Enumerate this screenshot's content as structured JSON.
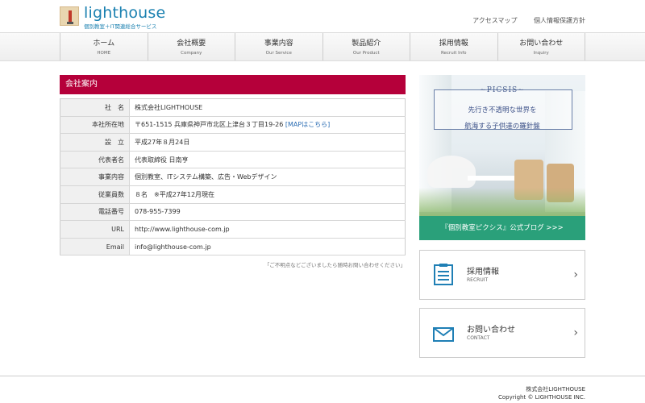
{
  "header": {
    "logo_text": "lighthouse",
    "logo_sub": "個別教室＋IT関連総合サービス",
    "links": [
      "アクセスマップ",
      "個人情報保護方針"
    ]
  },
  "nav": [
    {
      "jp": "ホーム",
      "en": "HOME"
    },
    {
      "jp": "会社概要",
      "en": "Company"
    },
    {
      "jp": "事業内容",
      "en": "Our Service"
    },
    {
      "jp": "製品紹介",
      "en": "Our Product"
    },
    {
      "jp": "採用情報",
      "en": "Recruit Info"
    },
    {
      "jp": "お問い合わせ",
      "en": "Inquiry"
    }
  ],
  "company": {
    "title": "会社案内",
    "rows": [
      {
        "label": "社　名",
        "value": "株式会社LIGHTHOUSE"
      },
      {
        "label": "本社所在地",
        "value": "〒651-1515 兵庫県神戸市北区上津台３丁目19-26",
        "link": "[MAPはこちら]"
      },
      {
        "label": "設　立",
        "value": "平成27年８月24日"
      },
      {
        "label": "代表者名",
        "value": "代表取締役 日南亨"
      },
      {
        "label": "事業内容",
        "value": "個別教室、ITシステム構築、広告・Webデザイン"
      },
      {
        "label": "従業員数",
        "value": "８名　※平成27年12月現在"
      },
      {
        "label": "電話番号",
        "value": "078-955-7399"
      },
      {
        "label": "URL",
        "value": "http://www.lighthouse-com.jp"
      },
      {
        "label": "Email",
        "value": "info@lighthouse-com.jp"
      }
    ],
    "note": "「ご不明点などございましたら随時お問い合わせください」"
  },
  "banner": {
    "title": "~PICSIS~",
    "line1": "先行き不透明な世界を",
    "line2": "航海する子供達の羅針盤",
    "cta": "『個別教室ピクシス』公式ブログ >>>"
  },
  "cards": [
    {
      "title": "採用情報",
      "en": "RECRUIT",
      "icon": "clipboard-icon"
    },
    {
      "title": "お問い合わせ",
      "en": "CONTACT",
      "icon": "envelope-icon"
    }
  ],
  "footer": {
    "company": "株式会社LIGHTHOUSE",
    "copyright": "Copyright © LIGHTHOUSE INC."
  },
  "colors": {
    "accent": "#b5003a",
    "brand": "#1a80b0",
    "banner_cta": "#2aa07a",
    "icon": "#1f7fb5"
  }
}
